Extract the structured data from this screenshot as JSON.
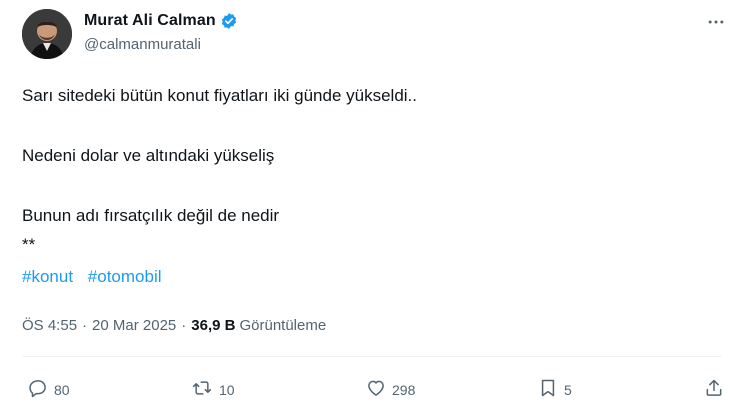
{
  "author": {
    "display_name": "Murat Ali Calman",
    "handle": "@calmanmuratali",
    "verified": true
  },
  "tweet": {
    "line1": "Sarı sitedeki bütün konut fiyatları iki günde yükseldi..",
    "line2": "Nedeni dolar ve altındaki yükseliş",
    "line3": "Bunun adı fırsatçılık değil de nedir",
    "line4": "**",
    "hashtags": [
      "#konut",
      "#otomobil"
    ]
  },
  "meta": {
    "time": "ÖS 4:55",
    "separator": "·",
    "date": "20 Mar 2025",
    "views_count": "36,9 B",
    "views_label": "Görüntüleme"
  },
  "actions": {
    "replies": "80",
    "retweets": "10",
    "likes": "298",
    "bookmarks": "5"
  },
  "colors": {
    "accent": "#1d9bf0",
    "text": "#0f1419",
    "secondary": "#536471"
  }
}
